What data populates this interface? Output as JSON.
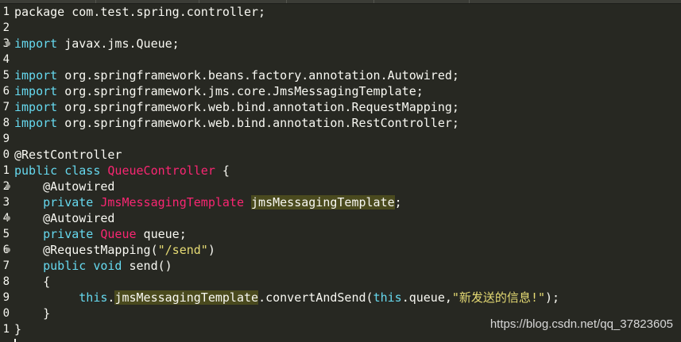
{
  "editor": {
    "file_content": [
      {
        "ln": "1",
        "fold": false,
        "tokens": [
          {
            "t": "package com.test.spring.controller;",
            "c": ""
          }
        ]
      },
      {
        "ln": "2",
        "fold": false,
        "tokens": []
      },
      {
        "ln": "3",
        "fold": true,
        "tokens": [
          {
            "t": "import",
            "c": "kw"
          },
          {
            "t": " javax.jms.Queue;",
            "c": ""
          }
        ]
      },
      {
        "ln": "4",
        "fold": false,
        "tokens": []
      },
      {
        "ln": "5",
        "fold": false,
        "tokens": [
          {
            "t": "import",
            "c": "kw"
          },
          {
            "t": " org.springframework.beans.factory.annotation.Autowired;",
            "c": ""
          }
        ]
      },
      {
        "ln": "6",
        "fold": false,
        "tokens": [
          {
            "t": "import",
            "c": "kw"
          },
          {
            "t": " org.springframework.jms.core.JmsMessagingTemplate;",
            "c": ""
          }
        ]
      },
      {
        "ln": "7",
        "fold": false,
        "tokens": [
          {
            "t": "import",
            "c": "kw"
          },
          {
            "t": " org.springframework.web.bind.annotation.RequestMapping;",
            "c": ""
          }
        ]
      },
      {
        "ln": "8",
        "fold": false,
        "tokens": [
          {
            "t": "import",
            "c": "kw"
          },
          {
            "t": " org.springframework.web.bind.annotation.RestController;",
            "c": ""
          }
        ]
      },
      {
        "ln": "9",
        "fold": false,
        "tokens": []
      },
      {
        "ln": "0",
        "fold": false,
        "tokens": [
          {
            "t": "@RestController",
            "c": ""
          }
        ]
      },
      {
        "ln": "1",
        "fold": false,
        "tokens": [
          {
            "t": "public class",
            "c": "kw"
          },
          {
            "t": " ",
            "c": ""
          },
          {
            "t": "QueueController",
            "c": "ty"
          },
          {
            "t": " {",
            "c": ""
          }
        ]
      },
      {
        "ln": "2",
        "fold": true,
        "tokens": [
          {
            "t": "    @Autowired",
            "c": ""
          }
        ]
      },
      {
        "ln": "3",
        "fold": false,
        "tokens": [
          {
            "t": "    private",
            "c": "kw"
          },
          {
            "t": " ",
            "c": ""
          },
          {
            "t": "JmsMessagingTemplate",
            "c": "ty"
          },
          {
            "t": " ",
            "c": ""
          },
          {
            "t": "jmsMessagingTemplate",
            "c": "hl"
          },
          {
            "t": ";",
            "c": ""
          }
        ]
      },
      {
        "ln": "4",
        "fold": true,
        "tokens": [
          {
            "t": "    @Autowired",
            "c": ""
          }
        ]
      },
      {
        "ln": "5",
        "fold": false,
        "tokens": [
          {
            "t": "    private",
            "c": "kw"
          },
          {
            "t": " ",
            "c": ""
          },
          {
            "t": "Queue",
            "c": "ty"
          },
          {
            "t": " queue;",
            "c": ""
          }
        ]
      },
      {
        "ln": "6",
        "fold": true,
        "tokens": [
          {
            "t": "    @RequestMapping(",
            "c": ""
          },
          {
            "t": "\"/send\"",
            "c": "st"
          },
          {
            "t": ")",
            "c": ""
          }
        ]
      },
      {
        "ln": "7",
        "fold": false,
        "tokens": [
          {
            "t": "    public void",
            "c": "kw"
          },
          {
            "t": " send()",
            "c": ""
          }
        ]
      },
      {
        "ln": "8",
        "fold": false,
        "tokens": [
          {
            "t": "    {",
            "c": ""
          }
        ]
      },
      {
        "ln": "9",
        "fold": false,
        "tokens": [
          {
            "t": "         ",
            "c": ""
          },
          {
            "t": "this",
            "c": "kw"
          },
          {
            "t": ".",
            "c": ""
          },
          {
            "t": "jmsMessagingTemplate",
            "c": "hl"
          },
          {
            "t": ".convertAndSend(",
            "c": ""
          },
          {
            "t": "this",
            "c": "kw"
          },
          {
            "t": ".queue,",
            "c": ""
          },
          {
            "t": "\"新发送的信息!\"",
            "c": "st"
          },
          {
            "t": ");",
            "c": ""
          }
        ]
      },
      {
        "ln": "0",
        "fold": false,
        "tokens": [
          {
            "t": "    }",
            "c": ""
          }
        ]
      },
      {
        "ln": "1",
        "fold": false,
        "tokens": [
          {
            "t": "}",
            "c": ""
          }
        ]
      }
    ]
  },
  "watermark": "https://blog.csdn.net/qq_37823605",
  "colors": {
    "background": "#272822",
    "keyword": "#66d9ef",
    "type": "#f92672",
    "string": "#e6db74",
    "highlight": "#4a4a1e"
  }
}
